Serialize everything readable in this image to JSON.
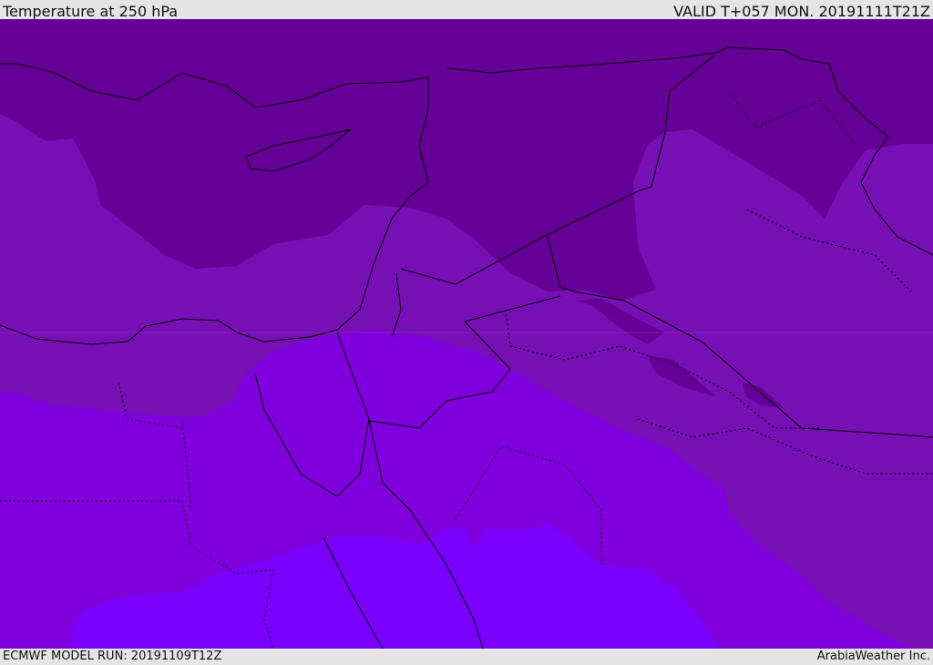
{
  "header": {
    "title": "Temperature at 250 hPa",
    "valid": "VALID T+057 MON. 20191111T21Z"
  },
  "footer": {
    "model_run": "ECMWF MODEL RUN: 20191109T12Z",
    "credit": "ArabiaWeather Inc."
  },
  "colors": {
    "band_coldest": "#650096",
    "band_cold": "#7610b5",
    "band_mid": "#7f00dd",
    "band_warm": "#7a00fe",
    "border": "#000000"
  }
}
